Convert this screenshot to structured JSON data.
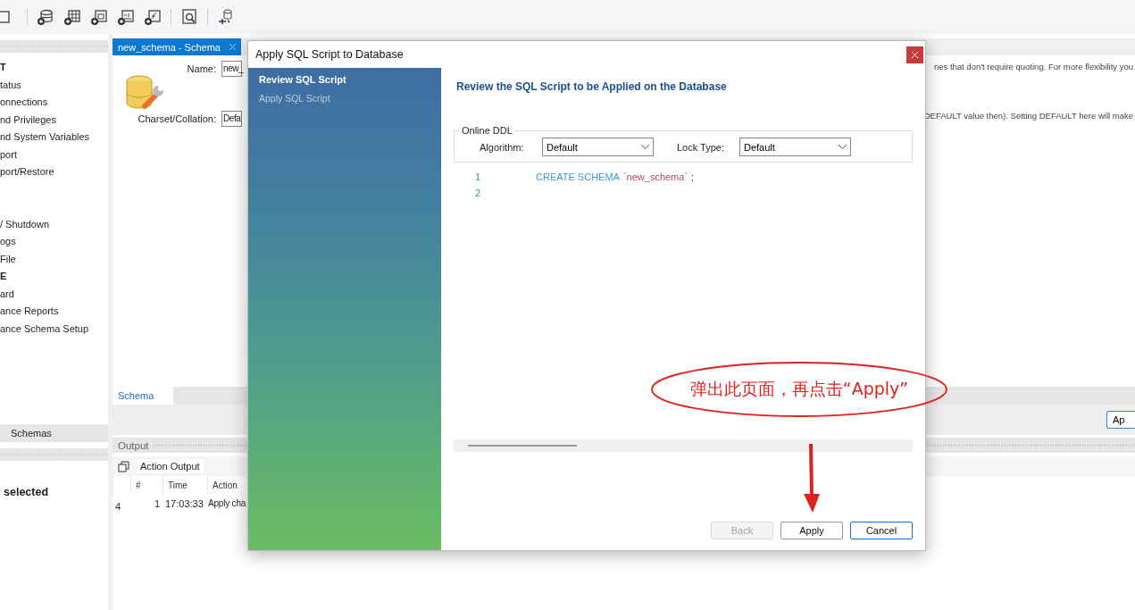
{
  "sidebar": {
    "sections": [
      {
        "heading": "T",
        "items": [
          "tatus",
          "onnections",
          "nd Privileges",
          "nd System Variables",
          "port",
          "port/Restore"
        ]
      },
      {
        "items": [
          "/ Shutdown",
          "ogs",
          "File"
        ]
      },
      {
        "heading": "E",
        "items": [
          "ard",
          "ance Reports",
          "ance Schema Setup"
        ]
      }
    ],
    "tab": "Schemas",
    "info_text": "selected"
  },
  "editor": {
    "tabs": [
      {
        "title": "new_schema - Schema",
        "selected": true
      }
    ],
    "name_label": "Name:",
    "name_value": "new_",
    "charset_label": "Charset/Collation:",
    "charset_value": "Defa",
    "hint_1": "nes that don't require quoting. For more flexibility you",
    "hint_2": "DEFAULT value then). Setting DEFAULT here will make",
    "bottom_tabs": [
      {
        "label": "Schema",
        "selected": true
      }
    ],
    "apply_button": "Ap"
  },
  "output": {
    "title": "Output",
    "mode": "Action Output",
    "columns": [
      "#",
      "Time",
      "Action"
    ],
    "rows": [
      {
        "column_1": "4",
        "number": "1",
        "time": "17:03:33",
        "action": "Apply cha"
      }
    ]
  },
  "dialog": {
    "title": "Apply SQL Script to Database",
    "steps": [
      {
        "label": "Review SQL Script",
        "selected": true
      },
      {
        "label": "Apply SQL Script",
        "selected": false
      }
    ],
    "heading": "Review the SQL Script to be Applied on the Database",
    "online_ddl": {
      "title": "Online DDL",
      "fields": [
        {
          "label": "Algorithm:",
          "value": "Default"
        },
        {
          "label": "Lock Type:",
          "value": "Default"
        }
      ]
    },
    "script": [
      {
        "number": "1",
        "tokens": [
          {
            "kind": "keyword",
            "text": "CREATE SCHEMA"
          },
          {
            "kind": "identifier",
            "text": "`new_schema`"
          },
          {
            "kind": "plain",
            "text": ";"
          }
        ]
      },
      {
        "number": "2"
      }
    ],
    "buttons": [
      {
        "label": "Back",
        "disabled": true,
        "default": false
      },
      {
        "label": "Apply",
        "disabled": false,
        "default": false
      },
      {
        "label": "Cancel",
        "disabled": false,
        "default": true
      }
    ]
  },
  "annotation": {
    "text": "弹出此页面，再点击“Apply”"
  }
}
